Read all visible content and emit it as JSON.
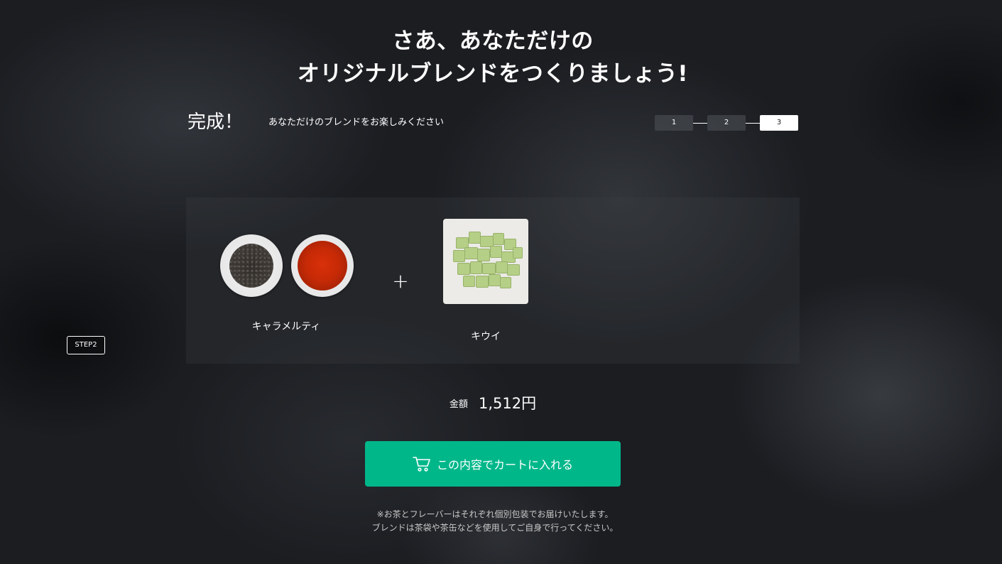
{
  "headline": {
    "line1": "さあ、あなただけの",
    "line2": "オリジナルブレンドをつくりましょう!"
  },
  "step": {
    "title": "完成！",
    "description": "あなただけのブレンドをお楽しみください",
    "steps": [
      "1",
      "2",
      "3"
    ],
    "active_step": "3",
    "badge": "STEP2"
  },
  "blend": {
    "tea": {
      "name": "キャラメルティ",
      "image_icons": [
        "tea-leaves-bowl-icon",
        "tea-liquor-cup-icon"
      ]
    },
    "plus": "+",
    "flavor": {
      "name": "キウイ",
      "image_icon": "dried-kiwi-icon"
    }
  },
  "price": {
    "label": "金額",
    "value": "1,512円"
  },
  "cart_button": {
    "label": "この内容でカートに入れる",
    "icon": "cart-icon"
  },
  "note": {
    "line1": "※お茶とフレーバーはそれぞれ個別包装でお届けいたします。",
    "line2": "ブレンドは茶袋や茶缶などを使用してご自身で行ってください。"
  },
  "colors": {
    "accent": "#00b78a",
    "background": "#1b1d21",
    "text": "#ffffff"
  }
}
